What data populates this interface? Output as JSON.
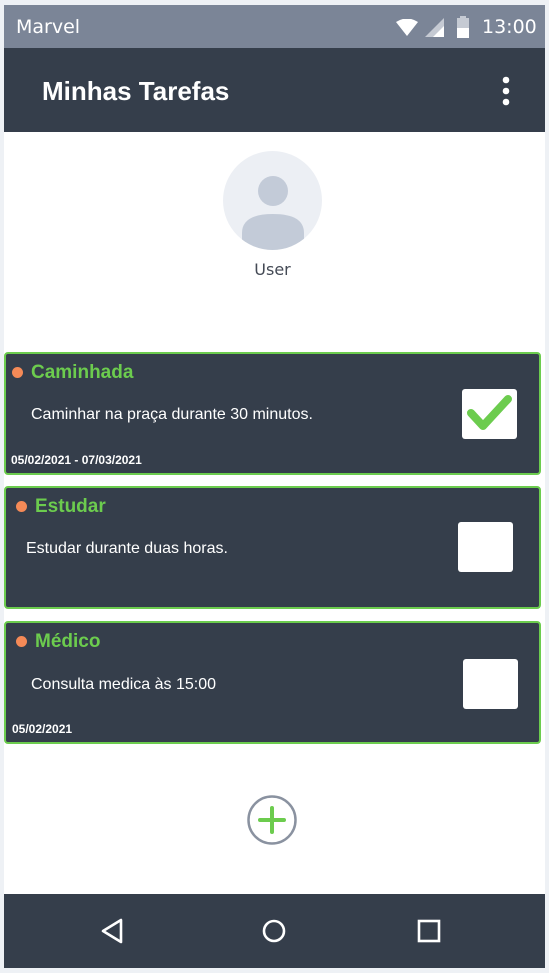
{
  "status_bar": {
    "carrier": "Marvel",
    "time": "13:00",
    "icons": [
      "wifi-icon",
      "signal-icon",
      "battery-icon"
    ]
  },
  "app_bar": {
    "title": "Minhas Tarefas",
    "menu_icon": "more-vert-icon"
  },
  "profile": {
    "avatar_icon": "user-avatar-icon",
    "name": "User"
  },
  "tasks": [
    {
      "title": "Caminhada",
      "description": "Caminhar na praça durante 30 minutos.",
      "date": "05/02/2021 - 07/03/2021",
      "completed": true
    },
    {
      "title": "Estudar",
      "description": "Estudar durante duas horas.",
      "date": "",
      "completed": false
    },
    {
      "title": "Médico",
      "description": "Consulta medica  às 15:00",
      "date": "05/02/2021",
      "completed": false
    }
  ],
  "add_button_icon": "add-circle-icon",
  "nav_bar": {
    "items": [
      "back-icon",
      "home-icon",
      "recents-icon"
    ]
  },
  "colors": {
    "accent": "#6ccc4e",
    "dark": "#353e4b",
    "status_bar": "#7b8597",
    "dot": "#f58a57"
  }
}
